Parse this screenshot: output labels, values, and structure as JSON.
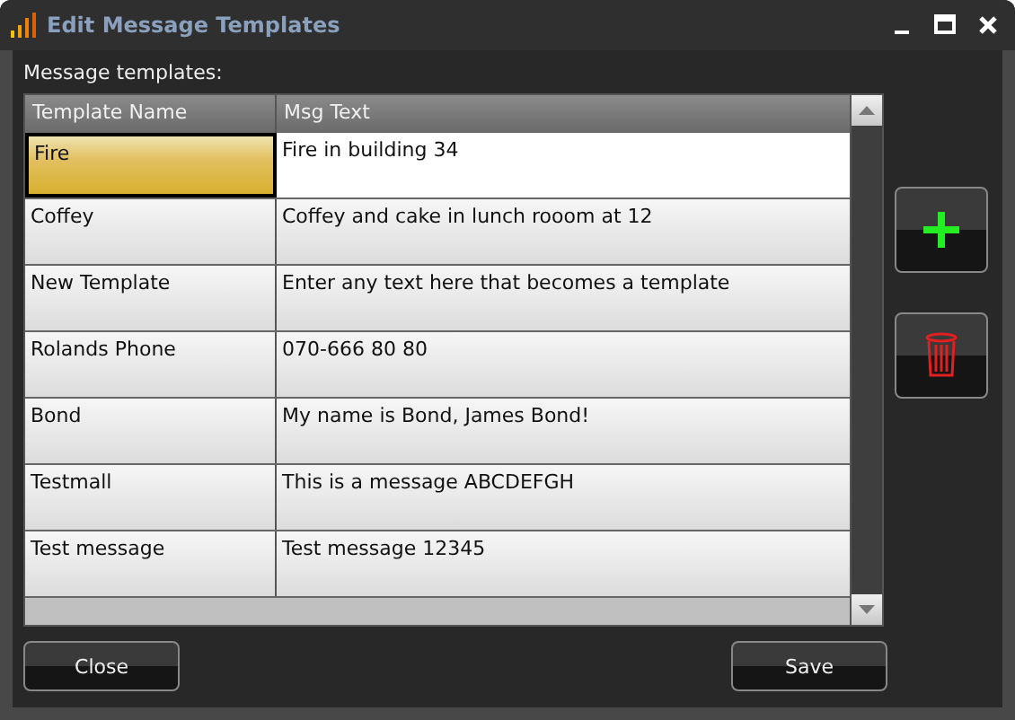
{
  "window": {
    "title": "Edit Message Templates"
  },
  "label": "Message templates:",
  "table": {
    "columns": [
      "Template Name",
      "Msg Text"
    ],
    "rows": [
      {
        "name": "Fire",
        "text": "Fire in building 34",
        "selected": true
      },
      {
        "name": "Coffey",
        "text": "Coffey and cake in lunch rooom at 12",
        "selected": false
      },
      {
        "name": "New Template",
        "text": "Enter any text here that becomes a template",
        "selected": false
      },
      {
        "name": "Rolands Phone",
        "text": "070-666 80 80",
        "selected": false
      },
      {
        "name": "Bond",
        "text": "My name is Bond, James Bond!",
        "selected": false
      },
      {
        "name": "Testmall",
        "text": "This is a message ABCDEFGH",
        "selected": false
      },
      {
        "name": "Test message",
        "text": "Test message 12345",
        "selected": false
      }
    ]
  },
  "buttons": [
    "Close",
    "Save"
  ]
}
